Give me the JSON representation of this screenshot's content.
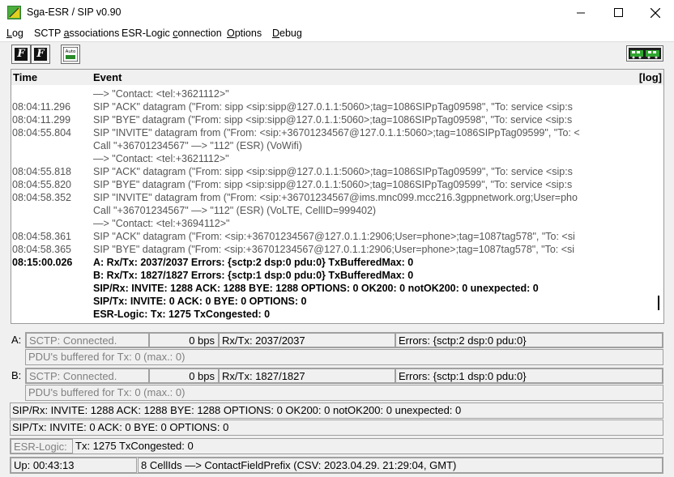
{
  "window": {
    "title": "Sga-ESR / SIP  v0.90"
  },
  "menu": [
    {
      "label": "Log",
      "ul": "L",
      "rest": "og"
    },
    {
      "label": "SCTP associations",
      "pre": "SCTP ",
      "ul": "a",
      "rest": "ssociations"
    },
    {
      "label": "ESR-Logic connection",
      "pre": "ESR-Logic ",
      "ul": "c",
      "rest": "onnection"
    },
    {
      "label": "Options",
      "ul": "O",
      "rest": "ptions"
    },
    {
      "label": "Debug",
      "ul": "D",
      "rest": "ebug"
    }
  ],
  "toolbar": {
    "btn1": "F",
    "btn2": "F",
    "auto": "Auto"
  },
  "log": {
    "col_time": "Time",
    "col_event": "Event",
    "col_log": "[log]",
    "rows": [
      {
        "time": "",
        "event": "—> \"Contact: <tel:+3621112>\"",
        "bold": false
      },
      {
        "time": "08:04:11.296",
        "event": "SIP \"ACK\" datagram (\"From: sipp <sip:sipp@127.0.1.1:5060>;tag=1086SIPpTag09598\", \"To: service <sip:s",
        "bold": false
      },
      {
        "time": "08:04:11.299",
        "event": "SIP \"BYE\" datagram (\"From: sipp <sip:sipp@127.0.1.1:5060>;tag=1086SIPpTag09598\", \"To: service <sip:s",
        "bold": false
      },
      {
        "time": "08:04:55.804",
        "event": "SIP \"INVITE\" datagram from (\"From: <sip:+36701234567@127.0.1.1:5060>;tag=1086SIPpTag09599\", \"To: <",
        "bold": false
      },
      {
        "time": "",
        "event": "Call \"+36701234567\" —> \"112\" (ESR) (VoWifi)",
        "bold": false
      },
      {
        "time": "",
        "event": "—> \"Contact: <tel:+3621112>\"",
        "bold": false
      },
      {
        "time": "08:04:55.818",
        "event": "SIP \"ACK\" datagram (\"From: sipp <sip:sipp@127.0.1.1:5060>;tag=1086SIPpTag09599\", \"To: service <sip:s",
        "bold": false
      },
      {
        "time": "08:04:55.820",
        "event": "SIP \"BYE\" datagram (\"From: sipp <sip:sipp@127.0.1.1:5060>;tag=1086SIPpTag09599\", \"To: service <sip:s",
        "bold": false
      },
      {
        "time": "08:04:58.352",
        "event": "SIP \"INVITE\" datagram from (\"From: <sip:+36701234567@ims.mnc099.mcc216.3gppnetwork.org;User=pho",
        "bold": false
      },
      {
        "time": "",
        "event": "Call \"+36701234567\" —> \"112\" (ESR) (VoLTE, CellID=999402)",
        "bold": false
      },
      {
        "time": "",
        "event": "—> \"Contact: <tel:+3694112>\"",
        "bold": false
      },
      {
        "time": "08:04:58.361",
        "event": "SIP \"ACK\" datagram (\"From: <sip:+36701234567@127.0.1.1:2906;User=phone>;tag=1087tag578\", \"To: <si",
        "bold": false
      },
      {
        "time": "08:04:58.365",
        "event": "SIP \"BYE\" datagram (\"From: <sip:+36701234567@127.0.1.1:2906;User=phone>;tag=1087tag578\", \"To: <si",
        "bold": false
      },
      {
        "time": "08:15:00.026",
        "event": "A:  Rx/Tx: 2037/2037   Errors: {sctp:2  dsp:0  pdu:0}   TxBufferedMax: 0",
        "bold": true
      },
      {
        "time": "",
        "event": "B:  Rx/Tx: 1827/1827   Errors: {sctp:1  dsp:0  pdu:0}   TxBufferedMax: 0",
        "bold": true
      },
      {
        "time": "",
        "event": "SIP/Rx:   INVITE: 1288   ACK: 1288   BYE: 1288   OPTIONS: 0   OK200: 0   notOK200: 0   unexpected: 0",
        "bold": true
      },
      {
        "time": "",
        "event": "SIP/Tx:   INVITE: 0   ACK: 0   BYE: 0   OPTIONS: 0",
        "bold": true
      },
      {
        "time": "",
        "event": "ESR-Logic:   Tx: 1275   TxCongested: 0",
        "bold": true
      }
    ]
  },
  "assoc_a": {
    "label": "A:",
    "state": "SCTP:  Connected.",
    "rate": "0 bps",
    "rxtx": "Rx/Tx: 2037/2037",
    "errors": "Errors: {sctp:2  dsp:0  pdu:0}",
    "buffered": "PDU's buffered for Tx: 0  (max.: 0)"
  },
  "assoc_b": {
    "label": "B:",
    "state": "SCTP:  Connected.",
    "rate": "0 bps",
    "rxtx": "Rx/Tx: 1827/1827",
    "errors": "Errors: {sctp:1  dsp:0  pdu:0}",
    "buffered": "PDU's buffered for Tx: 0  (max.: 0)"
  },
  "sip_rx": "SIP/Rx:   INVITE: 1288   ACK: 1288   BYE: 1288   OPTIONS: 0   OK200: 0   notOK200: 0   unexpected: 0",
  "sip_tx": "SIP/Tx:   INVITE: 0   ACK: 0   BYE: 0   OPTIONS: 0",
  "esr": {
    "label": "ESR-Logic:",
    "stats": "Tx: 1275   TxCongested: 0"
  },
  "status": {
    "uptime": "Up: 00:43:13",
    "cells": "8 CellIds —> ContactFieldPrefix  (CSV: 2023.04.29. 21:29:04, GMT)"
  },
  "colors": {
    "green_icon": "#2a8a2a",
    "grey_text": "#808080"
  }
}
